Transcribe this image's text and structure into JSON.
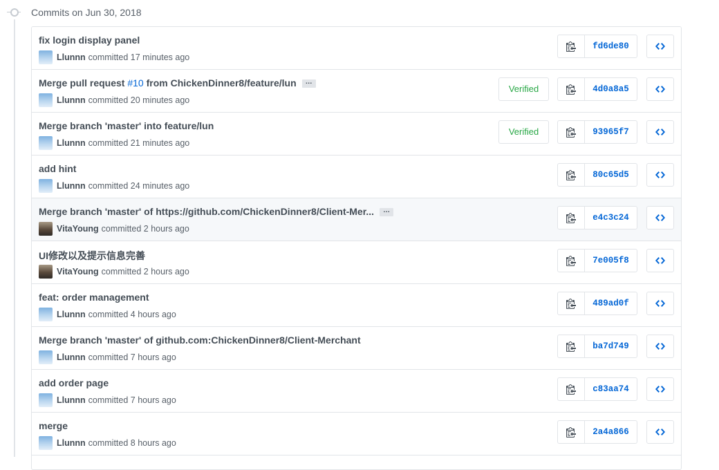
{
  "date_header": "Commits on Jun 30, 2018",
  "commits": [
    {
      "title": "fix login display panel",
      "author": "Llunnn",
      "avatar": "sky",
      "time": "committed 17 minutes ago",
      "sha": "fd6de80"
    },
    {
      "title_prefix": "Merge pull request ",
      "issue_ref": "#10",
      "title_suffix": " from ChickenDinner8/feature/lun",
      "author": "Llunnn",
      "avatar": "sky",
      "time": "committed 20 minutes ago",
      "sha": "4d0a8a5",
      "verified": "Verified",
      "has_ellipsis": true
    },
    {
      "title": "Merge branch 'master' into feature/lun",
      "author": "Llunnn",
      "avatar": "sky",
      "time": "committed 21 minutes ago",
      "sha": "93965f7",
      "verified": "Verified"
    },
    {
      "title": "add hint",
      "author": "Llunnn",
      "avatar": "sky",
      "time": "committed 24 minutes ago",
      "sha": "80c65d5"
    },
    {
      "title": "Merge branch 'master' of https://github.com/ChickenDinner8/Client-Mer...",
      "author": "VitaYoung",
      "avatar": "person",
      "time": "committed 2 hours ago",
      "sha": "e4c3c24",
      "has_ellipsis": true,
      "highlight": true
    },
    {
      "title": "UI修改以及提示信息完善",
      "author": "VitaYoung",
      "avatar": "person",
      "time": "committed 2 hours ago",
      "sha": "7e005f8"
    },
    {
      "title": "feat: order management",
      "author": "Llunnn",
      "avatar": "sky",
      "time": "committed 4 hours ago",
      "sha": "489ad0f"
    },
    {
      "title": "Merge branch 'master' of github.com:ChickenDinner8/Client-Merchant",
      "author": "Llunnn",
      "avatar": "sky",
      "time": "committed 7 hours ago",
      "sha": "ba7d749"
    },
    {
      "title": "add order page",
      "author": "Llunnn",
      "avatar": "sky",
      "time": "committed 7 hours ago",
      "sha": "c83aa74"
    },
    {
      "title": "merge",
      "author": "Llunnn",
      "avatar": "sky",
      "time": "committed 8 hours ago",
      "sha": "2a4a866"
    }
  ],
  "icons": {
    "copy": "clipboard-icon",
    "browse": "code-icon",
    "timeline": "git-commit-icon"
  },
  "colors": {
    "link": "#0366d6",
    "verified": "#28a745",
    "border": "#e1e4e8",
    "highlight_row": "#f6f8fa"
  }
}
